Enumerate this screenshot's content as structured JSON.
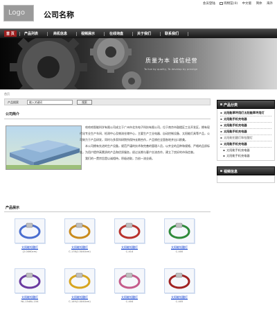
{
  "header": {
    "logo_text": "Logo",
    "company_name": "公司名称",
    "links": [
      "会员登陆",
      "购物篮(0)",
      "中文版",
      "简体",
      "海外"
    ]
  },
  "nav": {
    "items": [
      "首 页",
      "产品列表",
      "商机信息",
      "视频展示",
      "在线询盘",
      "关于我们",
      "联系我们"
    ]
  },
  "banner": {
    "slogan": "质量为本  诚信经营",
    "subtitle": "To live by quality, To develop by prestige"
  },
  "breadcrumb": {
    "current": "首页"
  },
  "search": {
    "label": "产品搜索",
    "placeholder": "输入关键词",
    "button": "搜索"
  },
  "intro": {
    "title": "公司简介",
    "paragraphs": [
      "哈哈哈智能科学有限公司成立于广州市北东电子科技有限公司，位于南京市鼓楼区工业开发区，拥有现代化专业生产车间、检测中心及物流仓储中心，主要生产工业电器、自动控制设备、太阳能灯具等产品，公司致力于产品研发，同时与多家科研院所保持长期合作，产品销往全国各地并出口欧美。",
      "本公司拥有先进的生产设备，规范严谨的技术和完善的管理人员，以齐全的品种和规格、严格的品质标准，为用户提供高素质的产品和优质服务，经过长期与客户交流合作，建立了良好的市场信誉。",
      "我们的一贯宗旨是以诚相待，积极进取，力创一流业绩。"
    ]
  },
  "products": {
    "title": "产品展示",
    "items": [
      {
        "name": "太阳能铅酸灯",
        "model": "(2.0X60cm)",
        "color": "#4a6ecf"
      },
      {
        "name": "太阳能铅酸灯",
        "model": "C-178(2.5X40cm)",
        "color": "#c98b1e"
      },
      {
        "name": "太阳能铅酸灯",
        "model": "C-414",
        "color": "#b8322d"
      },
      {
        "name": "太阳能铅酸灯",
        "model": "C-400",
        "color": "#2f8a3a"
      },
      {
        "name": "太阳能铅酸灯",
        "model": "NL-1548L-154",
        "color": "#6a3aa0"
      },
      {
        "name": "太阳能铅酸灯",
        "model": "C-149(2.0X40cm)",
        "color": "#d7a51f"
      },
      {
        "name": "太阳能铅酸灯",
        "model": "C-404",
        "color": "#c45b8b"
      },
      {
        "name": "太阳能铅酸灯",
        "model": "C-405",
        "color": "#a02222"
      }
    ]
  },
  "sidebar": {
    "categories_title": "产品分类",
    "categories": [
      {
        "label": "太阳能草坪用灯太阳能草坪用灯",
        "style": "bold"
      },
      {
        "label": "太阳能手机充电器",
        "style": "bold"
      },
      {
        "label": "太阳能手机充电器",
        "style": "bold"
      },
      {
        "label": "太阳能手机充电器",
        "style": "bold"
      },
      {
        "label": "太阳能铅酸灯和铅酸灯",
        "style": "plain"
      },
      {
        "label": "太阳能手机充电器",
        "style": "bold"
      },
      {
        "label": "太阳能手机充电器",
        "style": "sub"
      },
      {
        "label": "太阳能手机充电器",
        "style": "sub"
      }
    ],
    "video_title": "视频信息"
  },
  "colors": {
    "nav_active": "#9d1e1e",
    "link_blue": "#0033cc"
  }
}
